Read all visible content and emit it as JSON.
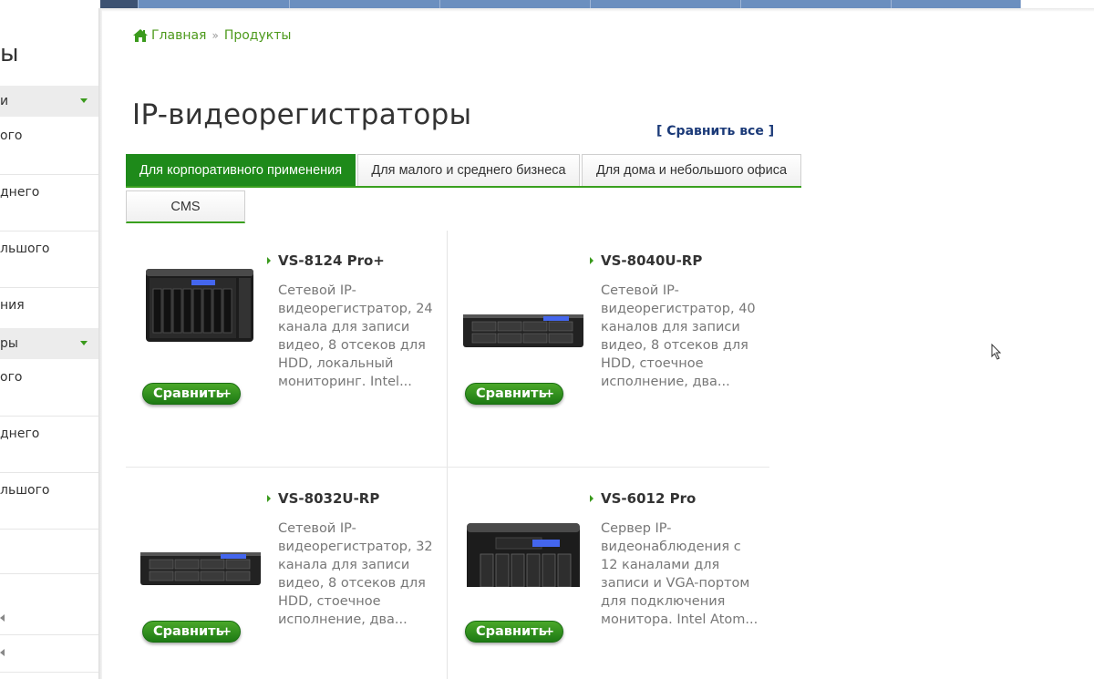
{
  "sidebar": {
    "title": "ы",
    "section1": "и",
    "section1_items": [
      "ого",
      "днего",
      "льшого",
      "ния"
    ],
    "section2": "ры",
    "section2_items": [
      "ого",
      "днего",
      "льшого"
    ]
  },
  "breadcrumb": {
    "home": "Главная",
    "separator": "»",
    "current": "Продукты"
  },
  "page": {
    "title": "IP-видеорегистраторы",
    "compare_all": "[ Сравнить все ]"
  },
  "tabs": [
    {
      "label": "Для корпоративного применения",
      "active": true
    },
    {
      "label": "Для малого и среднего бизнеса",
      "active": false
    },
    {
      "label": "Для дома и небольшого офиса",
      "active": false
    },
    {
      "label": "CMS",
      "active": false
    }
  ],
  "products": [
    {
      "name": "VS-8124 Pro+",
      "description": "Сетевой IP-видеорегистратор, 24 канала для записи видео, 8 отсеков для HDD, локальный мониторинг. Intel...",
      "compare_label": "Сравнить",
      "image": "tower-nvr-8bay"
    },
    {
      "name": "VS-8040U-RP",
      "description": "Сетевой IP-видеорегистратор, 40 каналов для записи видео, 8 отсеков для HDD, стоечное исполнение, два...",
      "compare_label": "Сравнить",
      "image": "rackmount-nvr"
    },
    {
      "name": "VS-8032U-RP",
      "description": "Сетевой IP-видеорегистратор, 32 канала для записи видео, 8 отсеков для HDD, стоечное исполнение, два...",
      "compare_label": "Сравнить",
      "image": "rackmount-nvr"
    },
    {
      "name": "VS-6012 Pro",
      "description": "Сервер IP-видеонаблюдения с 12 каналами для записи и VGA-портом для подключения монитора. Intel Atom...",
      "compare_label": "Сравнить",
      "image": "tower-nvr-6bay"
    }
  ],
  "icons": {
    "home": "home-icon",
    "plus": "+"
  },
  "colors": {
    "accent_green": "#1e8a1a",
    "link_green": "#4d9a1c",
    "compare_all_blue": "#1b3a78"
  }
}
